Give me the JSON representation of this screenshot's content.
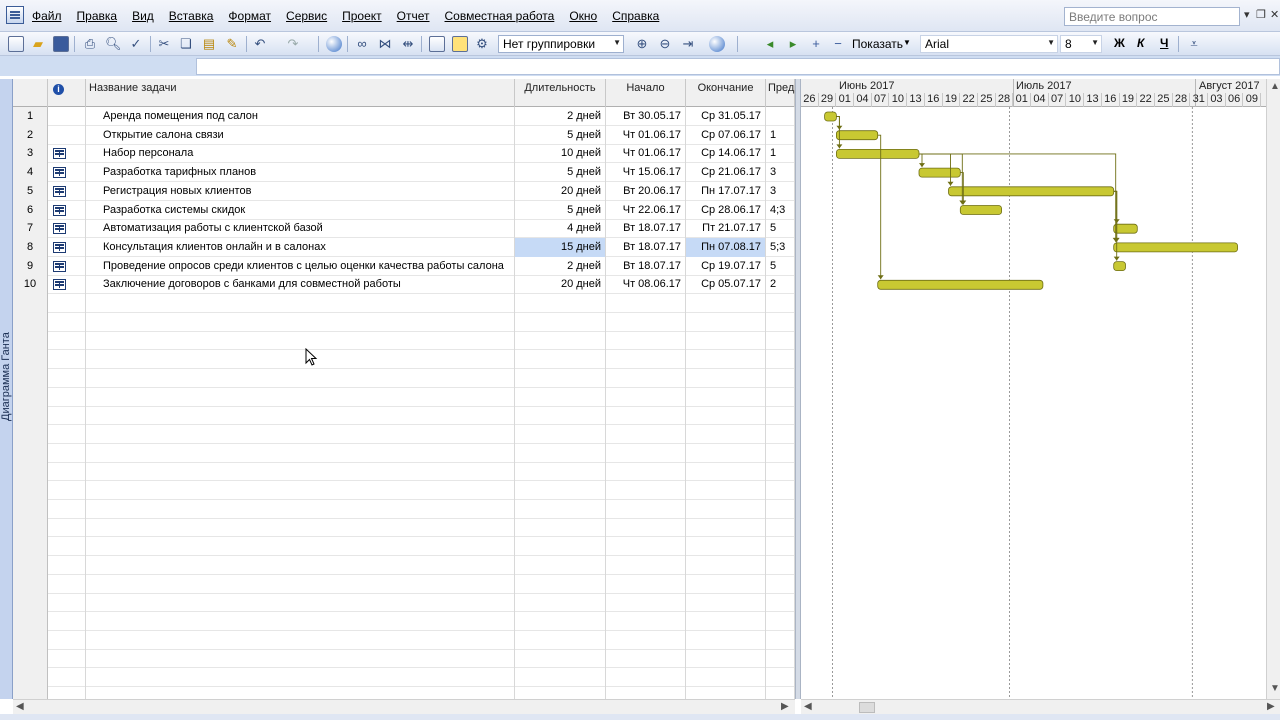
{
  "menubar": {
    "items": [
      "Файл",
      "Правка",
      "Вид",
      "Вставка",
      "Формат",
      "Сервис",
      "Проект",
      "Отчет",
      "Совместная работа",
      "Окно",
      "Справка"
    ],
    "ask_placeholder": "Введите вопрос"
  },
  "toolbar": {
    "grouping": "Нет группировки",
    "show_label": "Показать",
    "font": "Arial",
    "font_size": "8",
    "bold": "Ж",
    "italic": "К",
    "underline": "Ч"
  },
  "viewbar": {
    "label": "Диаграмма Ганта"
  },
  "table": {
    "columns": {
      "info": "i",
      "name": "Название задачи",
      "duration": "Длительность",
      "start": "Начало",
      "finish": "Окончание",
      "pred": "Пред"
    },
    "rows": [
      {
        "id": "1",
        "name": "Аренда помещения под салон",
        "duration": "2 дней",
        "start": "Вт 30.05.17",
        "finish": "Ср 31.05.17",
        "pred": ""
      },
      {
        "id": "2",
        "name": "Открытие салона связи",
        "duration": "5 дней",
        "start": "Чт 01.06.17",
        "finish": "Ср 07.06.17",
        "pred": "1"
      },
      {
        "id": "3",
        "name": "Набор персонала",
        "duration": "10 дней",
        "start": "Чт 01.06.17",
        "finish": "Ср 14.06.17",
        "pred": "1"
      },
      {
        "id": "4",
        "name": "Разработка тарифных планов",
        "duration": "5 дней",
        "start": "Чт 15.06.17",
        "finish": "Ср 21.06.17",
        "pred": "3"
      },
      {
        "id": "5",
        "name": "Регистрация новых клиентов",
        "duration": "20 дней",
        "start": "Вт 20.06.17",
        "finish": "Пн 17.07.17",
        "pred": "3"
      },
      {
        "id": "6",
        "name": "Разработка системы скидок",
        "duration": "5 дней",
        "start": "Чт 22.06.17",
        "finish": "Ср 28.06.17",
        "pred": "4;3"
      },
      {
        "id": "7",
        "name": "Автоматизация работы с клиентской базой",
        "duration": "4 дней",
        "start": "Вт 18.07.17",
        "finish": "Пт 21.07.17",
        "pred": "5"
      },
      {
        "id": "8",
        "name": "Консультация клиентов онлайн и в салонах",
        "duration": "15 дней",
        "start": "Вт 18.07.17",
        "finish": "Пн 07.08.17",
        "pred": "5;3"
      },
      {
        "id": "9",
        "name": "Проведение опросов среди клиентов с целью оценки качества работы салона",
        "duration": "2 дней",
        "start": "Вт 18.07.17",
        "finish": "Ср 19.07.17",
        "pred": "5"
      },
      {
        "id": "10",
        "name": "Заключение договоров с банками для совместной работы",
        "duration": "20 дней",
        "start": "Чт 08.06.17",
        "finish": "Ср 05.07.17",
        "pred": "2"
      }
    ]
  },
  "gantt": {
    "months": [
      "Июнь 2017",
      "Июль 2017",
      "Август 2017"
    ],
    "days": [
      "26",
      "29",
      "01",
      "04",
      "07",
      "10",
      "13",
      "16",
      "19",
      "22",
      "25",
      "28",
      "01",
      "04",
      "07",
      "10",
      "13",
      "16",
      "19",
      "22",
      "25",
      "28",
      "31",
      "03",
      "06",
      "09"
    ],
    "bar_color": "#c8c832"
  },
  "colors": {
    "selection": "#c6daf6",
    "bar": "#c8c832",
    "bar_border": "#6e6e14",
    "link": "#6e6e14"
  }
}
